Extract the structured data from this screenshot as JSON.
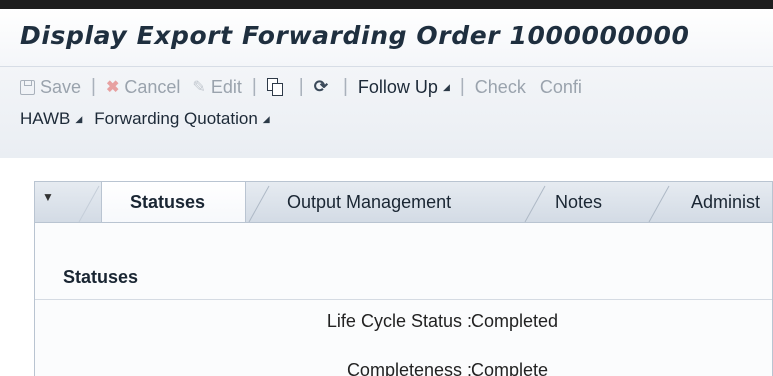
{
  "title": "Display Export Forwarding Order 1000000000",
  "toolbar": {
    "save": "Save",
    "cancel": "Cancel",
    "edit": "Edit",
    "follow_up": "Follow Up",
    "check": "Check",
    "confirm": "Confi",
    "hawb": "HAWB",
    "forwarding_quotation": "Forwarding Quotation"
  },
  "tabs": [
    {
      "label": "Statuses",
      "active": true
    },
    {
      "label": "Output Management",
      "active": false
    },
    {
      "label": "Notes",
      "active": false
    },
    {
      "label": "Administ",
      "active": false
    }
  ],
  "section": {
    "title": "Statuses",
    "fields": [
      {
        "label": "Life Cycle Status :",
        "value": "Completed"
      },
      {
        "label": "Completeness :",
        "value": "Complete"
      }
    ]
  },
  "icons": {
    "save": "save-icon",
    "cancel": "cancel-icon",
    "edit": "edit-icon",
    "copy": "copy-icon",
    "refresh": "refresh-icon",
    "tab_menu": "triangle-down-icon"
  }
}
